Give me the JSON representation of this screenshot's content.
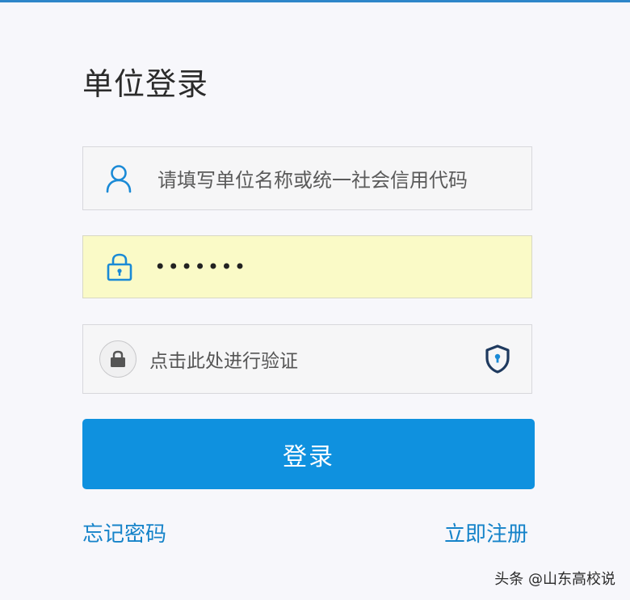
{
  "page_title": "单位登录",
  "username": {
    "placeholder": "请填写单位名称或统一社会信用代码",
    "icon": "user-icon"
  },
  "password": {
    "masked_value": "•••••••",
    "icon": "lock-icon"
  },
  "verify": {
    "label": "点击此处进行验证",
    "icon": "padlock-icon",
    "badge_icon": "shield-icon"
  },
  "login_button": {
    "label": "登录"
  },
  "links": {
    "forgot_password": "忘记密码",
    "register": "立即注册"
  },
  "watermark": "头条 @山东高校说",
  "colors": {
    "primary": "#0f91df",
    "link": "#1583c9",
    "password_bg": "#fafac7",
    "shield": "#1f3a5f"
  }
}
